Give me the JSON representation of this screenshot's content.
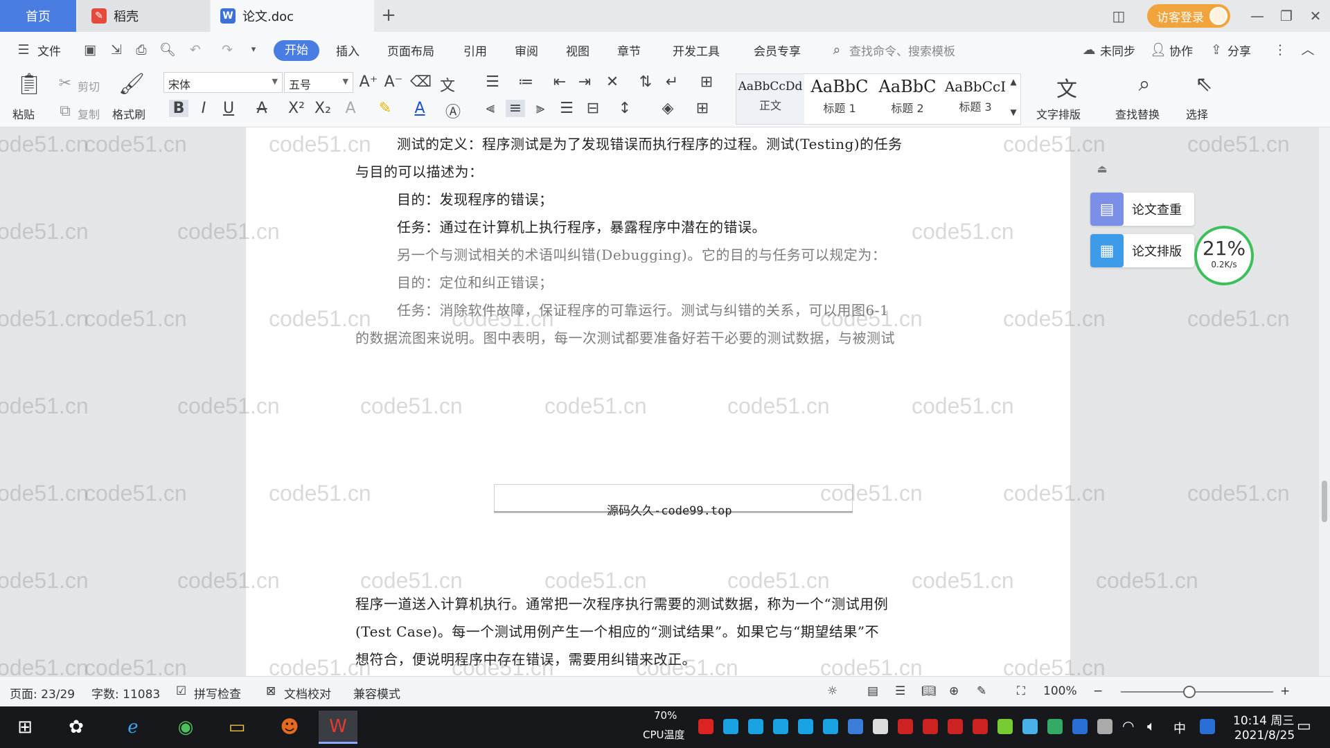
{
  "tabs": {
    "home": "首页",
    "daoke": "稻壳",
    "document": "论文.doc"
  },
  "header": {
    "login_label": "访客登录"
  },
  "menu": {
    "file": "文件",
    "items": [
      "开始",
      "插入",
      "页面布局",
      "引用",
      "审阅",
      "视图",
      "章节",
      "开发工具",
      "会员专享"
    ],
    "search_placeholder": "查找命令、搜索模板",
    "sync": "未同步",
    "collab": "协作",
    "share": "分享"
  },
  "ribbon": {
    "paste": "粘贴",
    "cut": "剪切",
    "copy": "复制",
    "format_painter": "格式刷",
    "font_name": "宋体",
    "font_size": "五号",
    "styles": [
      {
        "sample": "AaBbCcDd",
        "name": "正文"
      },
      {
        "sample": "AaBbC",
        "name": "标题 1"
      },
      {
        "sample": "AaBbC",
        "name": "标题 2"
      },
      {
        "sample": "AaBbCcI",
        "name": "标题 3"
      }
    ],
    "text_layout": "文字排版",
    "find_replace": "查找替换",
    "select": "选择"
  },
  "document": {
    "lines": [
      "测试的定义：程序测试是为了发现错误而执行程序的过程。测试(Testing)的任务",
      "与目的可以描述为：",
      "目的：发现程序的错误；",
      "任务：通过在计算机上执行程序，暴露程序中潜在的错误。",
      "另一个与测试相关的术语叫纠错(Debugging)。它的目的与任务可以规定为：",
      "目的：定位和纠正错误；",
      "任务：消除软件故障，保证程序的可靠运行。测试与纠错的关系，可以用图6-1",
      "的数据流图来说明。图中表明，每一次测试都要准备好若干必要的测试数据，与被测试"
    ],
    "caption": "源码久久-code99.top",
    "page2_lines": [
      "程序一道送入计算机执行。通常把一次程序执行需要的测试数据，称为一个“测试用例",
      "(Test Case)。每一个测试用例产生一个相应的“测试结果”。如果它与“期望结果”不",
      "想符合，便说明程序中存在错误，需要用纠错来改正。"
    ]
  },
  "side_panel": {
    "check": "论文查重",
    "layout": "论文排版",
    "speed_percent": "21%",
    "speed_rate": "0.2K/s"
  },
  "watermark": "code51.cn",
  "statusbar": {
    "page": "页面: 23/29",
    "words": "字数: 11083",
    "spell": "拼写检查",
    "proof": "文档校对",
    "compat": "兼容模式",
    "zoom": "100%"
  },
  "taskbar": {
    "cpu_percent": "70%",
    "cpu_label": "CPU温度",
    "time": "10:14 周三",
    "date": "2021/8/25",
    "ime": "中"
  },
  "colors": {
    "accent": "#4a7de2",
    "login": "#f2a43c",
    "speed_ring": "#3dc05b"
  }
}
